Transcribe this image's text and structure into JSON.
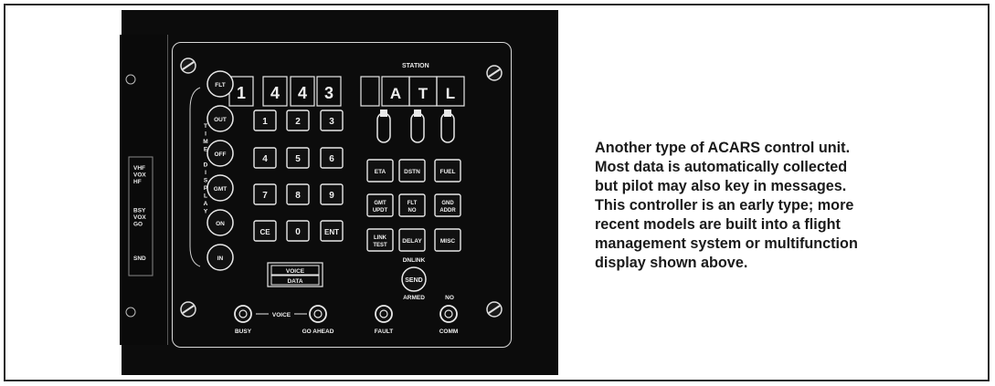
{
  "station_label": "STATION",
  "flight_digits": [
    "1",
    "4",
    "4",
    "3"
  ],
  "station_letters": [
    "A",
    "T",
    "L"
  ],
  "time_keys": [
    "FLT",
    "OUT",
    "OFF",
    "GMT",
    "ON",
    "IN"
  ],
  "time_display_text": "TIME DISPLAY",
  "keypad": [
    "1",
    "2",
    "3",
    "4",
    "5",
    "6",
    "7",
    "8",
    "9",
    "CE",
    "0",
    "ENT"
  ],
  "function_keys": [
    [
      "ETA"
    ],
    [
      "DSTN"
    ],
    [
      "FUEL"
    ],
    [
      "GMT",
      "UPDT"
    ],
    [
      "FLT",
      "NO"
    ],
    [
      "GND",
      "ADDR"
    ],
    [
      "LINK",
      "TEST"
    ],
    [
      "DELAY"
    ],
    [
      "MISC"
    ]
  ],
  "bracket_labels": [
    [
      "VHF",
      "VOX",
      "HF"
    ],
    [
      "BSY",
      "VOX",
      "GO"
    ],
    [
      "SND"
    ]
  ],
  "voice_data": [
    "VOICE",
    "DATA"
  ],
  "dnlink_label": "DNLINK",
  "send_label": "SEND",
  "armed_label": "ARMED",
  "no_label": "NO",
  "voice_label": "VOICE",
  "indicators": [
    "BUSY",
    "GO AHEAD",
    "FAULT",
    "COMM"
  ],
  "caption_lines": [
    "Another type of ACARS control  unit.",
    "Most data is automatically collected",
    "but pilot may also key in messages.",
    "This controller is an early type;  more",
    "recent models are built into a flight",
    "management system or multifunction",
    "display shown above."
  ]
}
